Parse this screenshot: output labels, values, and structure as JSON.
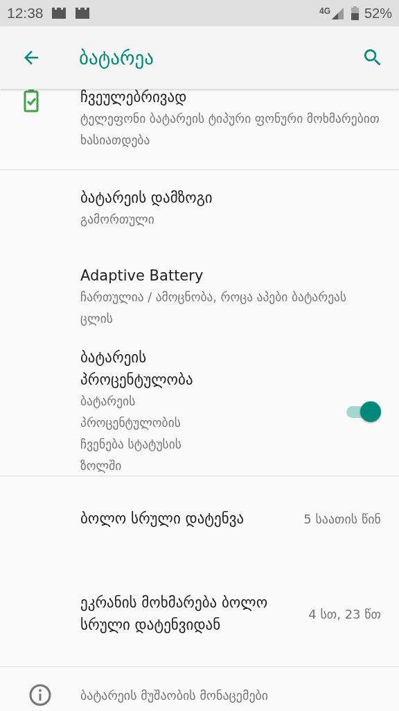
{
  "status_bar": {
    "time": "12:38",
    "network": "4G",
    "battery": "52%"
  },
  "app_bar": {
    "title": "ბატარეა"
  },
  "groups": [
    {
      "items": [
        {
          "kind": "icon",
          "title": "ჩვეულებრივად",
          "summary": "ტელეფონი ბატარეის ტიპური ფონური მოხმარებით ხასიათდება"
        }
      ]
    },
    {
      "items": [
        {
          "kind": "text",
          "title": "ბატარეის დამზოგი",
          "summary": "გამორთული"
        },
        {
          "kind": "text",
          "title": "Adaptive Battery",
          "summary": "ჩართულია / ამოცნობა, როცა აპები ბატარეას ცლის"
        },
        {
          "kind": "switch",
          "title": "ბატარეის პროცენტულობა",
          "summary": "ბატარეის პროცენტულობის ჩვენება სტატუსის ზოლში",
          "on": true
        }
      ]
    },
    {
      "items": [
        {
          "kind": "value",
          "title": "ბოლო სრული დატენვა",
          "value": "5 საათის წინ"
        },
        {
          "kind": "value",
          "title": "ეკრანის მოხმარება ბოლო სრული დატენვიდან",
          "value": "4 სთ, 23 წთ"
        }
      ]
    }
  ],
  "footer": {
    "text": "ბატარეის მუშაობის მონაცემები"
  }
}
